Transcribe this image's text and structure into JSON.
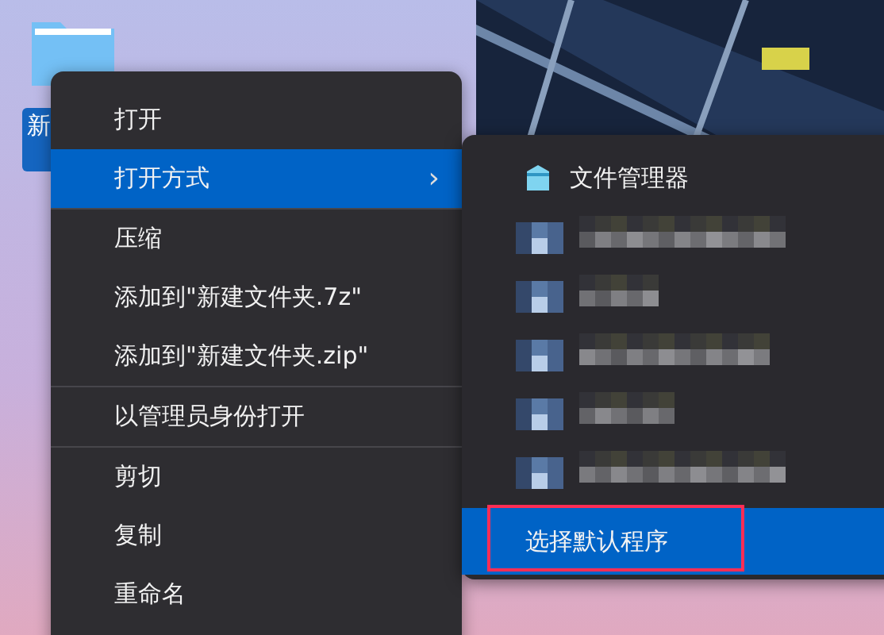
{
  "desktop_icon": {
    "label": "新",
    "selected": true
  },
  "context_menu": {
    "items": [
      {
        "kind": "item",
        "label": "打开",
        "selected": false
      },
      {
        "kind": "item",
        "label": "打开方式",
        "selected": true,
        "arrow": "›"
      },
      {
        "kind": "separator"
      },
      {
        "kind": "item",
        "label": "压缩",
        "selected": false
      },
      {
        "kind": "item",
        "label": "添加到\"新建文件夹.7z\"",
        "selected": false
      },
      {
        "kind": "item",
        "label": "添加到\"新建文件夹.zip\"",
        "selected": false
      },
      {
        "kind": "separator"
      },
      {
        "kind": "item",
        "label": "以管理员身份打开",
        "selected": false
      },
      {
        "kind": "separator"
      },
      {
        "kind": "item",
        "label": "剪切",
        "selected": false
      },
      {
        "kind": "item",
        "label": "复制",
        "selected": false
      },
      {
        "kind": "item",
        "label": "重命名",
        "selected": false
      }
    ]
  },
  "submenu": {
    "items": [
      {
        "kind": "app",
        "label": "文件管理器",
        "selected": false
      },
      {
        "kind": "blurred",
        "selected": false
      },
      {
        "kind": "blurred",
        "selected": false
      },
      {
        "kind": "blurred",
        "selected": false
      },
      {
        "kind": "blurred",
        "selected": false
      },
      {
        "kind": "blurred",
        "selected": false
      },
      {
        "kind": "action",
        "label": "选择默认程序",
        "selected": true,
        "outlined": true
      }
    ]
  }
}
